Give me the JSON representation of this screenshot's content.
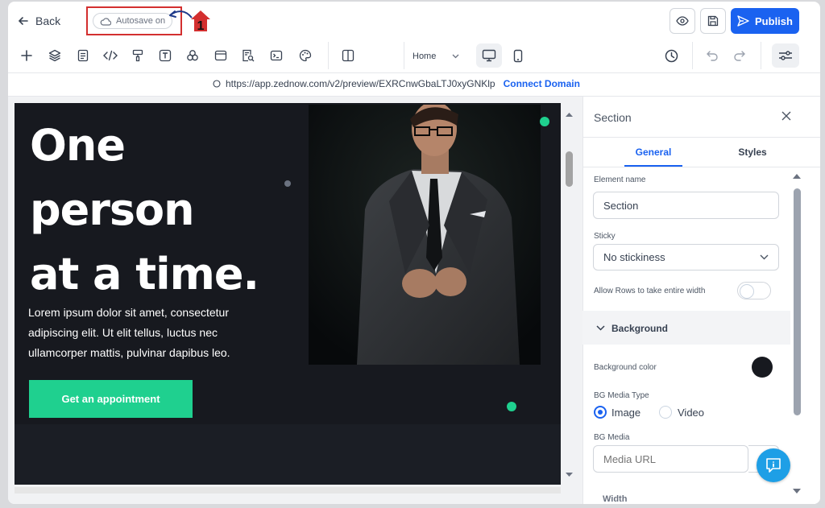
{
  "topbar": {
    "back_label": "Back",
    "autosave_label": "Autosave on",
    "annotation_number": "1",
    "publish_label": "Publish"
  },
  "toolbar": {
    "tools": [
      "plus-icon",
      "layers-icon",
      "page-icon",
      "code-icon",
      "paint-roller-icon",
      "text-icon",
      "shapes-icon",
      "browser-icon",
      "search-document-icon",
      "terminal-icon",
      "palette-icon",
      "columns-icon"
    ],
    "page_select": "Home",
    "history_icon": "clock-icon"
  },
  "url_bar": {
    "url": "https://app.zednow.com/v2/preview/EXRCnwGbaLTJ0xyGNKlp",
    "connect_label": "Connect Domain"
  },
  "canvas": {
    "headline": [
      "One",
      "person",
      "at a time."
    ],
    "body": "Lorem ipsum dolor sit amet, consectetur adipiscing elit. Ut elit tellus, luctus nec ullamcorper mattis, pulvinar dapibus leo.",
    "cta_label": "Get an appointment"
  },
  "panel": {
    "title": "Section",
    "tabs": [
      {
        "label": "General",
        "active": true
      },
      {
        "label": "Styles",
        "active": false
      }
    ],
    "element_name_label": "Element name",
    "element_name_value": "Section",
    "sticky_label": "Sticky",
    "sticky_value": "No stickiness",
    "rows_width_label": "Allow Rows to take entire width",
    "rows_width_on": false,
    "background_heading": "Background",
    "bg_color_label": "Background color",
    "bg_color_value": "#17191f",
    "bg_media_type_label": "BG Media Type",
    "media_types": [
      {
        "label": "Image",
        "selected": true
      },
      {
        "label": "Video",
        "selected": false
      }
    ],
    "bg_media_label": "BG Media",
    "media_url_placeholder": "Media URL",
    "next_section_label": "Width"
  },
  "colors": {
    "accent": "#1a62f0",
    "cta_green": "#1fd08f",
    "hero_bg": "#17191f",
    "annotation_red": "#d32f2f"
  }
}
